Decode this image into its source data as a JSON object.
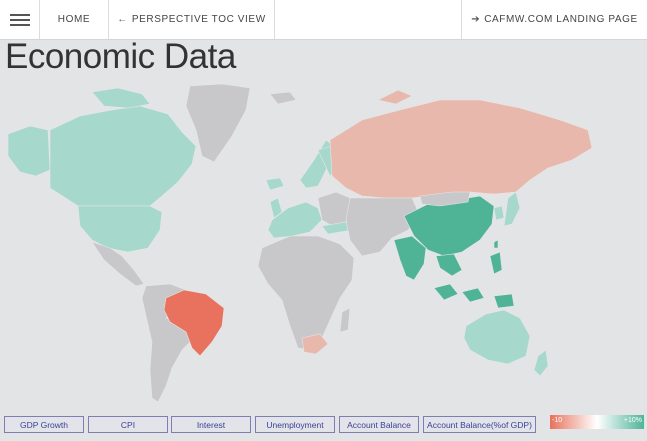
{
  "nav": {
    "home_label": "HOME",
    "toc_label": "PERSPECTIVE TOC VIEW",
    "landing_label": "CAFMW.COM LANDING PAGE"
  },
  "page": {
    "title": "Economic Data"
  },
  "icons": {
    "menu": "hamburger-menu-icon",
    "toc": "arrow-left-icon",
    "landing": "circle-arrow-icon"
  },
  "colors": {
    "background": "#e3e4e6",
    "land_no_data": "#c8c8ca",
    "negative_strong": "#e8725d",
    "negative_light": "#e8b8ad",
    "positive_light": "#a6d9cc",
    "positive_strong": "#4fb496"
  },
  "tabs": [
    {
      "label": "GDP Growth"
    },
    {
      "label": "CPI"
    },
    {
      "label": "Interest"
    },
    {
      "label": "Unemployment"
    },
    {
      "label": "Account Balance"
    },
    {
      "label": "Account Balance(%of GDP)"
    }
  ],
  "legend": {
    "min_label": "-10",
    "max_label": "+10%",
    "min": -10,
    "max": 10
  }
}
